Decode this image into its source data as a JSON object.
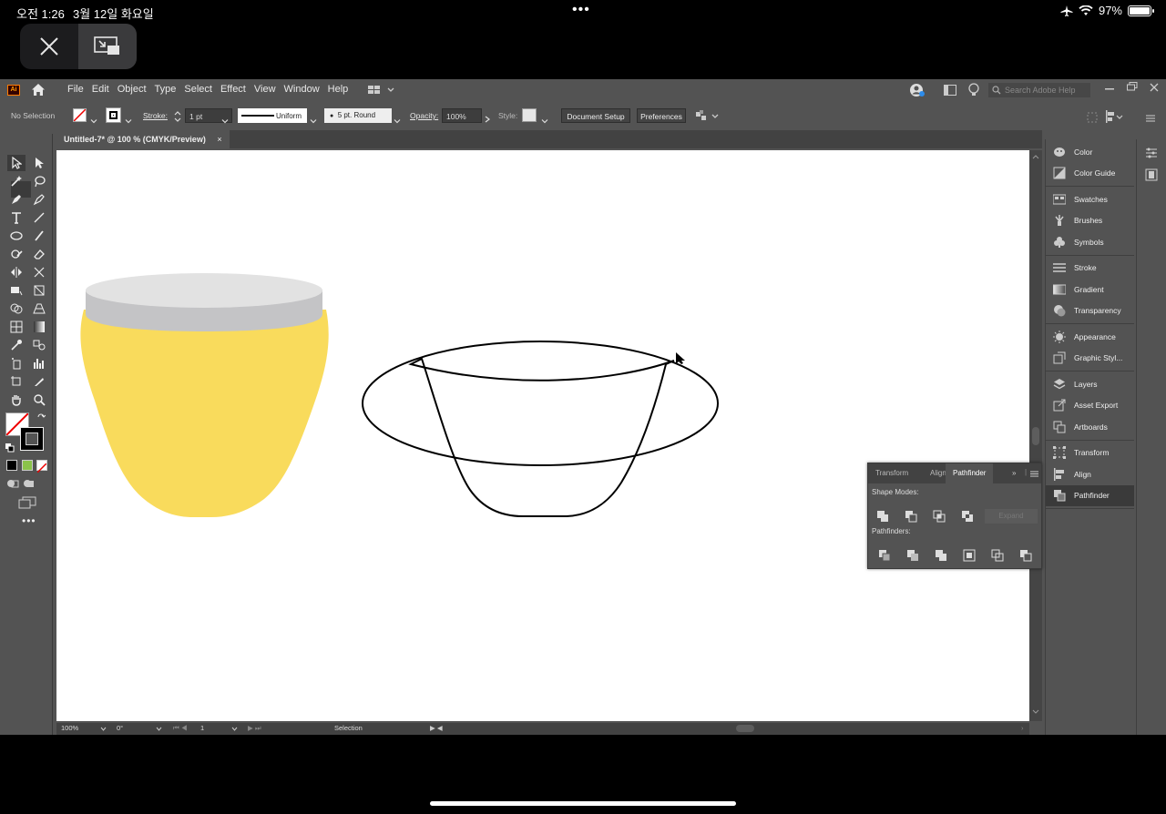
{
  "ios": {
    "time": "오전 1:26",
    "date": "3월 12일 화요일",
    "dots": "•••",
    "battery": "97%"
  },
  "menubar": {
    "logo": "Ai",
    "menus": [
      "File",
      "Edit",
      "Object",
      "Type",
      "Select",
      "Effect",
      "View",
      "Window",
      "Help"
    ],
    "search_placeholder": "Search Adobe Help"
  },
  "control": {
    "selection": "No Selection",
    "stroke_label": "Stroke:",
    "stroke_weight": "1 pt",
    "profile": "Uniform",
    "brush": "5 pt. Round",
    "opacity_label": "Opacity:",
    "opacity_value": "100%",
    "style_label": "Style:",
    "document_setup": "Document Setup",
    "preferences": "Preferences"
  },
  "document": {
    "tab_title": "Untitled-7* @ 100 % (CMYK/Preview)",
    "close": "×"
  },
  "status": {
    "zoom": "100%",
    "rotation": "0°",
    "artboard": "1",
    "tool": "Selection"
  },
  "dock": {
    "groups": [
      [
        {
          "label": "Color",
          "icon": "color-palette-icon"
        },
        {
          "label": "Color Guide",
          "icon": "color-guide-icon"
        }
      ],
      [
        {
          "label": "Swatches",
          "icon": "swatches-icon"
        },
        {
          "label": "Brushes",
          "icon": "brushes-icon"
        },
        {
          "label": "Symbols",
          "icon": "symbols-icon"
        }
      ],
      [
        {
          "label": "Stroke",
          "icon": "stroke-icon"
        },
        {
          "label": "Gradient",
          "icon": "gradient-icon"
        },
        {
          "label": "Transparency",
          "icon": "transparency-icon"
        }
      ],
      [
        {
          "label": "Appearance",
          "icon": "appearance-icon"
        },
        {
          "label": "Graphic Styl...",
          "icon": "graphic-styles-icon"
        }
      ],
      [
        {
          "label": "Layers",
          "icon": "layers-icon"
        },
        {
          "label": "Asset Export",
          "icon": "asset-export-icon"
        },
        {
          "label": "Artboards",
          "icon": "artboards-icon"
        }
      ],
      [
        {
          "label": "Transform",
          "icon": "transform-icon"
        },
        {
          "label": "Align",
          "icon": "align-icon"
        },
        {
          "label": "Pathfinder",
          "icon": "pathfinder-icon",
          "active": true
        }
      ]
    ]
  },
  "pathfinder_panel": {
    "tabs": [
      "Transform",
      "Align",
      "Pathfinder"
    ],
    "active_tab": "Pathfinder",
    "shape_modes_label": "Shape Modes:",
    "pathfinders_label": "Pathfinders:",
    "expand_label": "Expand"
  },
  "colors": {
    "cup_fill": "#f9db5c",
    "lid_top": "#e2e2e2",
    "lid_side": "#c4c4c6",
    "ui_bg": "#535353"
  }
}
